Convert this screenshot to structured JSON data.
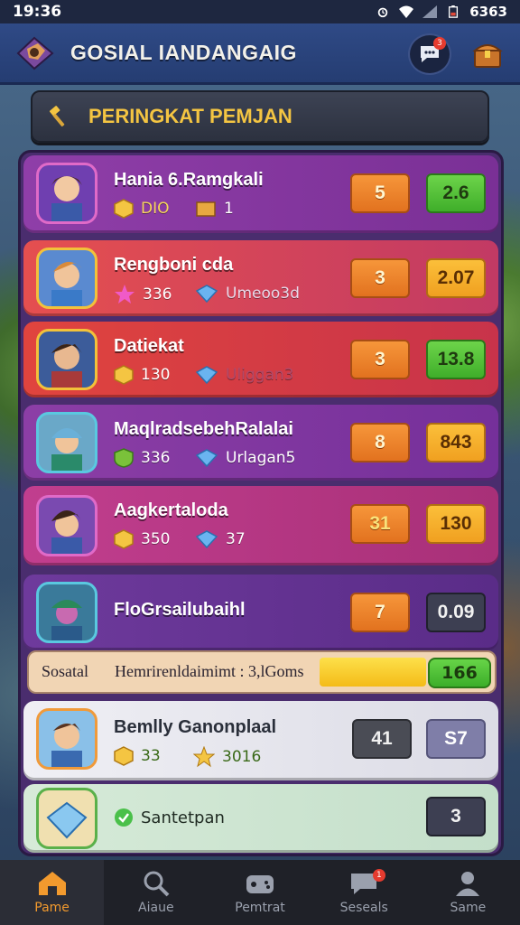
{
  "status_bar": {
    "time": "19:36",
    "right_text": "6363"
  },
  "app_bar": {
    "title": "GOSIAL IANDANGAIG",
    "chat_badge": "3"
  },
  "panel": {
    "title": "PERINGKAT PEMJAN"
  },
  "rows": [
    {
      "name": "Hania 6.Ramgkali",
      "stat1": "DIO",
      "stat2": "1",
      "box1": "5",
      "box2": "2.6",
      "color": "#8a3aa0"
    },
    {
      "name": "Rengboni cda",
      "stat1": "336",
      "stat2": "Umeoo3d",
      "box1": "3",
      "box2": "2.07",
      "color": "#e24a4a"
    },
    {
      "name": "Datiekat",
      "stat1": "130",
      "stat2": "Uliggan3",
      "box1": "3",
      "box2": "13.8",
      "color": "#d93c3c"
    },
    {
      "name": "MaqlradsebehRalalai",
      "stat1": "336",
      "stat2": "Urlagan5",
      "box1": "8",
      "box2": "843",
      "color": "#8a3aa0"
    },
    {
      "name": "Aagkertaloda",
      "stat1": "350",
      "stat2": "37",
      "box1": "31",
      "box2": "130",
      "color": "#b03a8a"
    },
    {
      "name": "FloGrsailubaihl",
      "box1": "7",
      "box2": "0.09",
      "color": "#6a3696"
    },
    {
      "name": "Bemlly Ganonplaal",
      "stat1": "33",
      "stat2": "3016",
      "box1": "41",
      "box2": "S7",
      "color": "#e6e6ec"
    },
    {
      "name": "Santetpan",
      "box2": "3",
      "color": "#cfe6d2"
    }
  ],
  "bonus": {
    "label": "Sosatal",
    "text": "Hemrirenldaimimt : 3,lGoms",
    "value": "166",
    "fill_fraction": 0.25
  },
  "nav": [
    {
      "label": "Pame",
      "icon": "home-icon"
    },
    {
      "label": "Aiaue",
      "icon": "search-icon"
    },
    {
      "label": "Pemtrat",
      "icon": "gamepad-icon"
    },
    {
      "label": "Seseals",
      "icon": "chat-icon",
      "badge": "1"
    },
    {
      "label": "Same",
      "icon": "profile-icon"
    }
  ],
  "colors": {
    "accent_gold": "#f4c542",
    "appbar": "#2f4a86",
    "board": "#4a2d6e",
    "nav_active": "#f29a2e"
  }
}
